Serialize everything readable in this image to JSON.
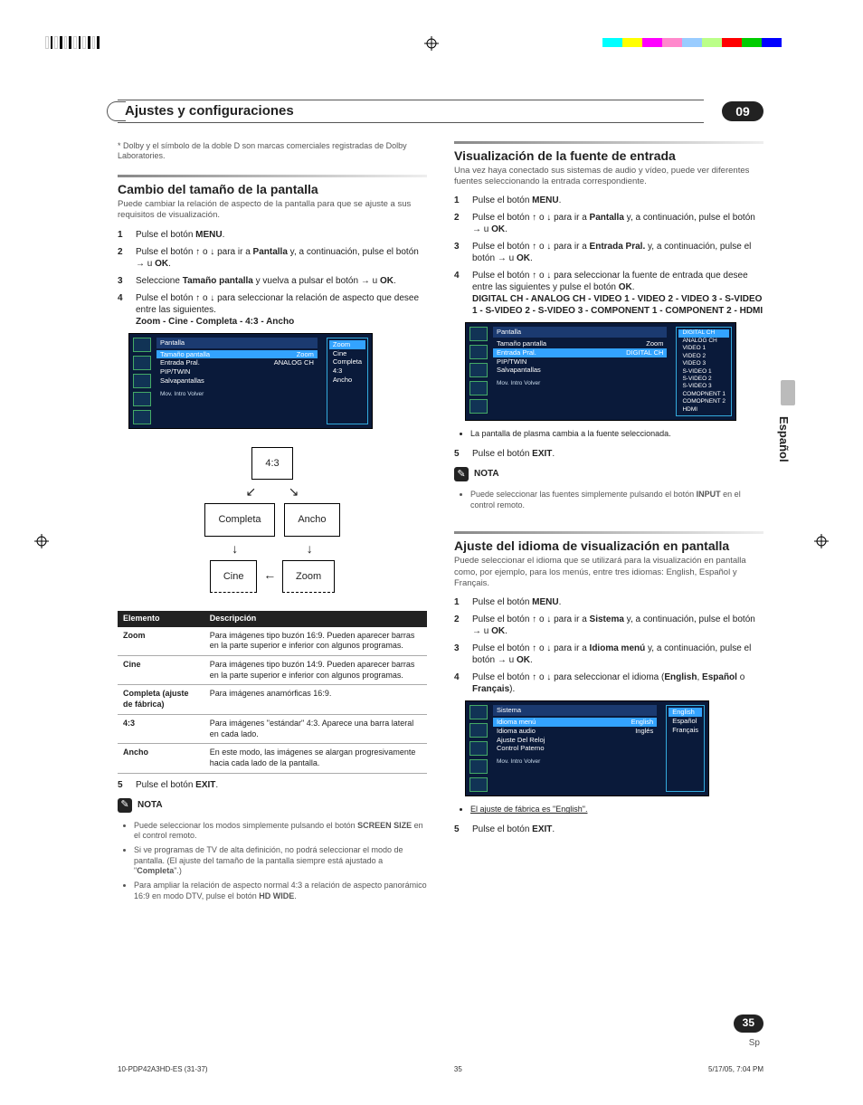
{
  "header": {
    "section_title": "Ajustes y configuraciones",
    "chapter": "09"
  },
  "side_tab": "Español",
  "page_number": "35",
  "page_lang_suffix": "Sp",
  "left": {
    "footnote": "* Dolby y el símbolo de la doble D son marcas comerciales registradas de Dolby Laboratories.",
    "h2": "Cambio del tamaño de la pantalla",
    "intro": "Puede cambiar la relación de aspecto de la pantalla para que se ajuste a sus requisitos de visualización.",
    "steps": [
      "Pulse el botón <b>MENU</b>.",
      "Pulse el botón <span class='arrow-glyph'>↑</span> o <span class='arrow-glyph'>↓</span> para ir a <b>Pantalla</b> y, a continuación, pulse el botón <span class='arrow-glyph'>→</span> u <b>OK</b>.",
      "Seleccione <b>Tamaño pantalla</b> y vuelva a pulsar el botón <span class='arrow-glyph'>→</span> u <b>OK</b>.",
      "Pulse el botón <span class='arrow-glyph'>↑</span> o <span class='arrow-glyph'>↓</span> para seleccionar la relación de aspecto que desee entre las siguientes.<br><b>Zoom - Cine - Completa - 4:3 - Ancho</b>"
    ],
    "menu1": {
      "title": "Pantalla",
      "rows": [
        {
          "l": "Tamaño pantalla",
          "r": "Zoom",
          "hl": true
        },
        {
          "l": "Entrada Pral.",
          "r": "ANALOG CH"
        },
        {
          "l": "PIP/TWIN",
          "r": ""
        },
        {
          "l": "Salvapantallas",
          "r": ""
        }
      ],
      "sub": [
        "Zoom",
        "Cine",
        "Completa",
        "4:3",
        "Ancho"
      ],
      "sub_hl": 0,
      "foot": "Mov.     Intro     Volver"
    },
    "diagram": {
      "b1": "4:3",
      "b2": "Completa",
      "b3": "Ancho",
      "b4": "Cine",
      "b5": "Zoom"
    },
    "table_head": {
      "c1": "Elemento",
      "c2": "Descripción"
    },
    "table": [
      {
        "k": "Zoom",
        "v": "Para imágenes tipo buzón 16:9. Pueden aparecer barras en la parte superior e inferior con algunos programas."
      },
      {
        "k": "Cine",
        "v": "Para imágenes tipo buzón 14:9. Pueden aparecer barras en la parte superior e inferior con algunos programas."
      },
      {
        "k": "Completa (ajuste de fábrica)",
        "v": "Para imágenes anamórficas 16:9."
      },
      {
        "k": "4:3",
        "v": "Para imágenes \"estándar\" 4:3. Aparece una barra lateral en cada lado."
      },
      {
        "k": "Ancho",
        "v": "En este modo, las imágenes se alargan progresivamente hacia cada lado de la pantalla."
      }
    ],
    "step5": "Pulse el botón <b>EXIT</b>.",
    "note_label": "NOTA",
    "notes": [
      "Puede seleccionar los modos simplemente pulsando el botón <b>SCREEN SIZE</b> en el control remoto.",
      "Si ve programas de TV de alta definición, no podrá seleccionar el modo de pantalla. (El ajuste del tamaño de la pantalla siempre está ajustado a \"<b>Completa</b>\".)",
      "Para ampliar la relación de aspecto normal 4:3 a relación de aspecto panorámico 16:9 en modo DTV, pulse el botón <b>HD WIDE</b>."
    ]
  },
  "right": {
    "h2a": "Visualización de la fuente de entrada",
    "intro_a": "Una vez haya conectado sus sistemas de audio y vídeo, puede ver diferentes fuentes seleccionando la entrada correspondiente.",
    "steps_a": [
      "Pulse el botón <b>MENU</b>.",
      "Pulse el botón <span class='arrow-glyph'>↑</span> o <span class='arrow-glyph'>↓</span> para ir a <b>Pantalla</b> y, a continuación, pulse el botón <span class='arrow-glyph'>→</span> u <b>OK</b>.",
      "Pulse el botón <span class='arrow-glyph'>↑</span> o <span class='arrow-glyph'>↓</span> para ir a <b>Entrada Pral.</b> y, a continuación, pulse el botón <span class='arrow-glyph'>→</span> u <b>OK</b>.",
      "Pulse el botón <span class='arrow-glyph'>↑</span> o <span class='arrow-glyph'>↓</span> para seleccionar la fuente de entrada que desee entre las siguientes y pulse el botón <b>OK</b>.<br><b>DIGITAL CH - ANALOG CH - VIDEO 1 - VIDEO 2 - VIDEO 3 - S-VIDEO 1 - S-VIDEO 2 - S-VIDEO 3 - COMPONENT 1 - COMPONENT 2 - HDMI</b>"
    ],
    "menu2": {
      "title": "Pantalla",
      "rows": [
        {
          "l": "Tamaño pantalla",
          "r": "Zoom"
        },
        {
          "l": "Entrada Pral.",
          "r": "DIGITAL CH",
          "hl": true
        },
        {
          "l": "PIP/TWIN",
          "r": ""
        },
        {
          "l": "Salvapantallas",
          "r": ""
        }
      ],
      "sub": [
        "DIGITAL CH",
        "ANALOG CH",
        "VIDEO 1",
        "VIDEO 2",
        "VIDEO 3",
        "S-VIDEO 1",
        "S-VIDEO 2",
        "S-VIDEO 3",
        "COMOPNENT 1",
        "COMOPNENT 2",
        "HDMI"
      ],
      "sub_hl": 0,
      "foot": "Mov.   Intro   Volver"
    },
    "bullet_a": "La pantalla de plasma cambia a la fuente seleccionada.",
    "step5a": "Pulse el botón <b>EXIT</b>.",
    "note_label": "NOTA",
    "note_a": "Puede seleccionar las fuentes simplemente pulsando el botón <b>INPUT</b> en el control remoto.",
    "h2b": "Ajuste del idioma de visualización en pantalla",
    "intro_b": "Puede seleccionar el idioma que se utilizará para la visualización en pantalla como, por ejemplo, para los menús, entre tres idiomas: English, Español y Français.",
    "steps_b": [
      "Pulse el botón <b>MENU</b>.",
      "Pulse el botón <span class='arrow-glyph'>↑</span> o <span class='arrow-glyph'>↓</span> para ir a <b>Sistema</b> y, a continuación, pulse el botón <span class='arrow-glyph'>→</span> u <b>OK</b>.",
      "Pulse el botón <span class='arrow-glyph'>↑</span> o <span class='arrow-glyph'>↓</span> para ir a <b>Idioma menú</b> y, a continuación, pulse el botón <span class='arrow-glyph'>→</span> u <b>OK</b>.",
      "Pulse el botón <span class='arrow-glyph'>↑</span> o <span class='arrow-glyph'>↓</span> para seleccionar el idioma (<b>English</b>, <b>Español</b> o <b>Français</b>)."
    ],
    "menu3": {
      "title": "Sistema",
      "rows": [
        {
          "l": "Idioma menú",
          "r": "English",
          "hl": true
        },
        {
          "l": "Idioma audio",
          "r": "Inglés"
        },
        {
          "l": "Ajuste Del Reloj",
          "r": ""
        },
        {
          "l": "Control Paterno",
          "r": ""
        }
      ],
      "sub": [
        "English",
        "Español",
        "Français"
      ],
      "sub_hl": 0,
      "foot": "Mov.   Intro   Volver"
    },
    "bullet_b": "El ajuste de fábrica es \"English\".",
    "step5b": "Pulse el botón <b>EXIT</b>."
  },
  "footer": {
    "left": "10-PDP42A3HD-ES (31-37)",
    "mid": "35",
    "right": "5/17/05, 7:04 PM"
  }
}
